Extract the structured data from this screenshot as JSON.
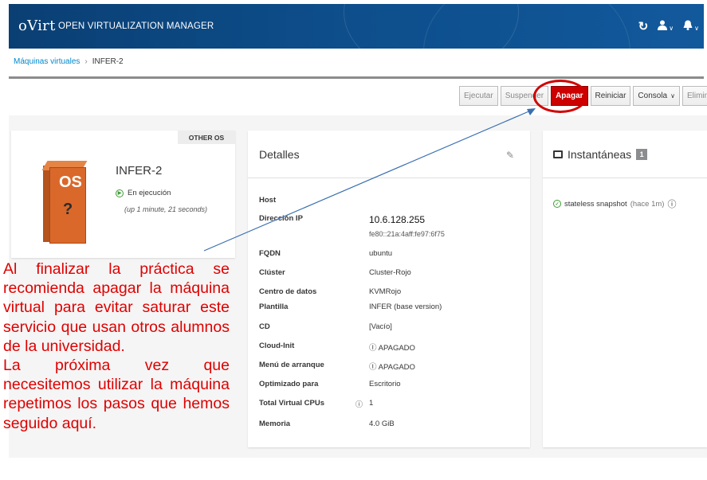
{
  "header": {
    "logo": "oVirt",
    "title": "OPEN VIRTUALIZATION MANAGER",
    "icons": [
      "refresh-icon",
      "user-icon",
      "bell-icon"
    ]
  },
  "breadcrumb": {
    "parent": "Máquinas virtuales",
    "separator": "›",
    "current": "INFER-2"
  },
  "toolbar": {
    "buttons": [
      {
        "label": "Ejecutar",
        "enabled": false
      },
      {
        "label": "Suspender",
        "enabled": false
      },
      {
        "label": "Apagar",
        "enabled": true,
        "style": "danger"
      },
      {
        "label": "Reiniciar",
        "enabled": true
      },
      {
        "label": "Consola",
        "enabled": true,
        "has_dropdown": true
      },
      {
        "label": "Eliminar",
        "enabled": false
      }
    ]
  },
  "vm_card": {
    "os_badge": "OTHER OS",
    "box_text": "OS",
    "box_question": "?",
    "name": "INFER-2",
    "status": "En ejecución",
    "uptime": "(up 1 minute, 21 seconds)"
  },
  "details": {
    "title": "Detalles",
    "rows": [
      {
        "label": "Host",
        "value": ""
      },
      {
        "label": "Dirección IP",
        "value": "10.6.128.255",
        "value2": "fe80::21a:4aff:fe97:6f75"
      },
      {
        "label": "FQDN",
        "value": "ubuntu"
      },
      {
        "label": "Clúster",
        "value": "Cluster-Rojo"
      },
      {
        "label": "Centro de datos",
        "value": "KVMRojo"
      },
      {
        "label": "Plantilla",
        "value": "INFER (base version)"
      },
      {
        "label": "CD",
        "value": "[Vacío]"
      },
      {
        "label": "Cloud-Init",
        "value": "APAGADO"
      },
      {
        "label": "Menú de arranque",
        "value": "APAGADO"
      },
      {
        "label": "Optimizado para",
        "value": "Escritorio"
      },
      {
        "label": "Total Virtual CPUs",
        "value": "1"
      },
      {
        "label": "Memoria",
        "value": "4.0 GiB"
      }
    ]
  },
  "snapshots": {
    "title": "Instantáneas",
    "count": "1",
    "items": [
      {
        "name": "stateless snapshot",
        "ago": "(hace 1m)"
      }
    ]
  },
  "annotation": {
    "paragraph1": "Al finalizar la práctica se recomienda apagar la máquina virtual para evitar saturar este servicio que usan otros alumnos de la universidad.",
    "paragraph2": "La próxima vez que necesitemos utilizar la máquina repetimos los pasos que hemos seguido aquí.",
    "color": "#e00000"
  },
  "colors": {
    "header_bg": "#0d4d8a",
    "link": "#0088ce",
    "danger": "#cc0000",
    "ok": "#3f9c35"
  }
}
